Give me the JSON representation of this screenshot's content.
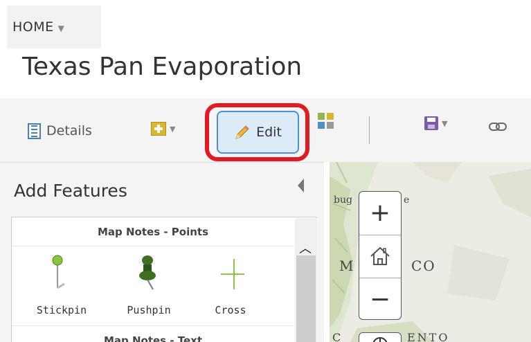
{
  "breadcrumb": {
    "home_label": "HOME",
    "caret": "▼"
  },
  "page": {
    "title": "Texas Pan Evaporation"
  },
  "toolbar": {
    "details_label": "Details",
    "add_icon": "map-notes-add-icon",
    "edit_label": "Edit",
    "layout_icon": "layout-grid-icon",
    "save_icon": "save-disk-icon",
    "link_icon": "link-icon",
    "highlight_color": "#e11b22",
    "edit_active_bg": "#dcebf8"
  },
  "panel": {
    "title": "Add Features",
    "groups": [
      {
        "name": "Map Notes - Points",
        "templates": [
          {
            "label": "Stickpin",
            "icon": "stickpin-icon"
          },
          {
            "label": "Pushpin",
            "icon": "pushpin-icon"
          },
          {
            "label": "Cross",
            "icon": "cross-icon"
          }
        ]
      },
      {
        "name": "Map Notes - Text"
      }
    ]
  },
  "map": {
    "labels": {
      "top": "bug",
      "top_suffix": "e",
      "mexico_left": "M",
      "mexico_right": "CO",
      "bottom_left": "C",
      "bottom_right": "ENTO"
    },
    "zoom_in": "+",
    "zoom_out": "−",
    "home_icon": "home-extent-icon"
  }
}
